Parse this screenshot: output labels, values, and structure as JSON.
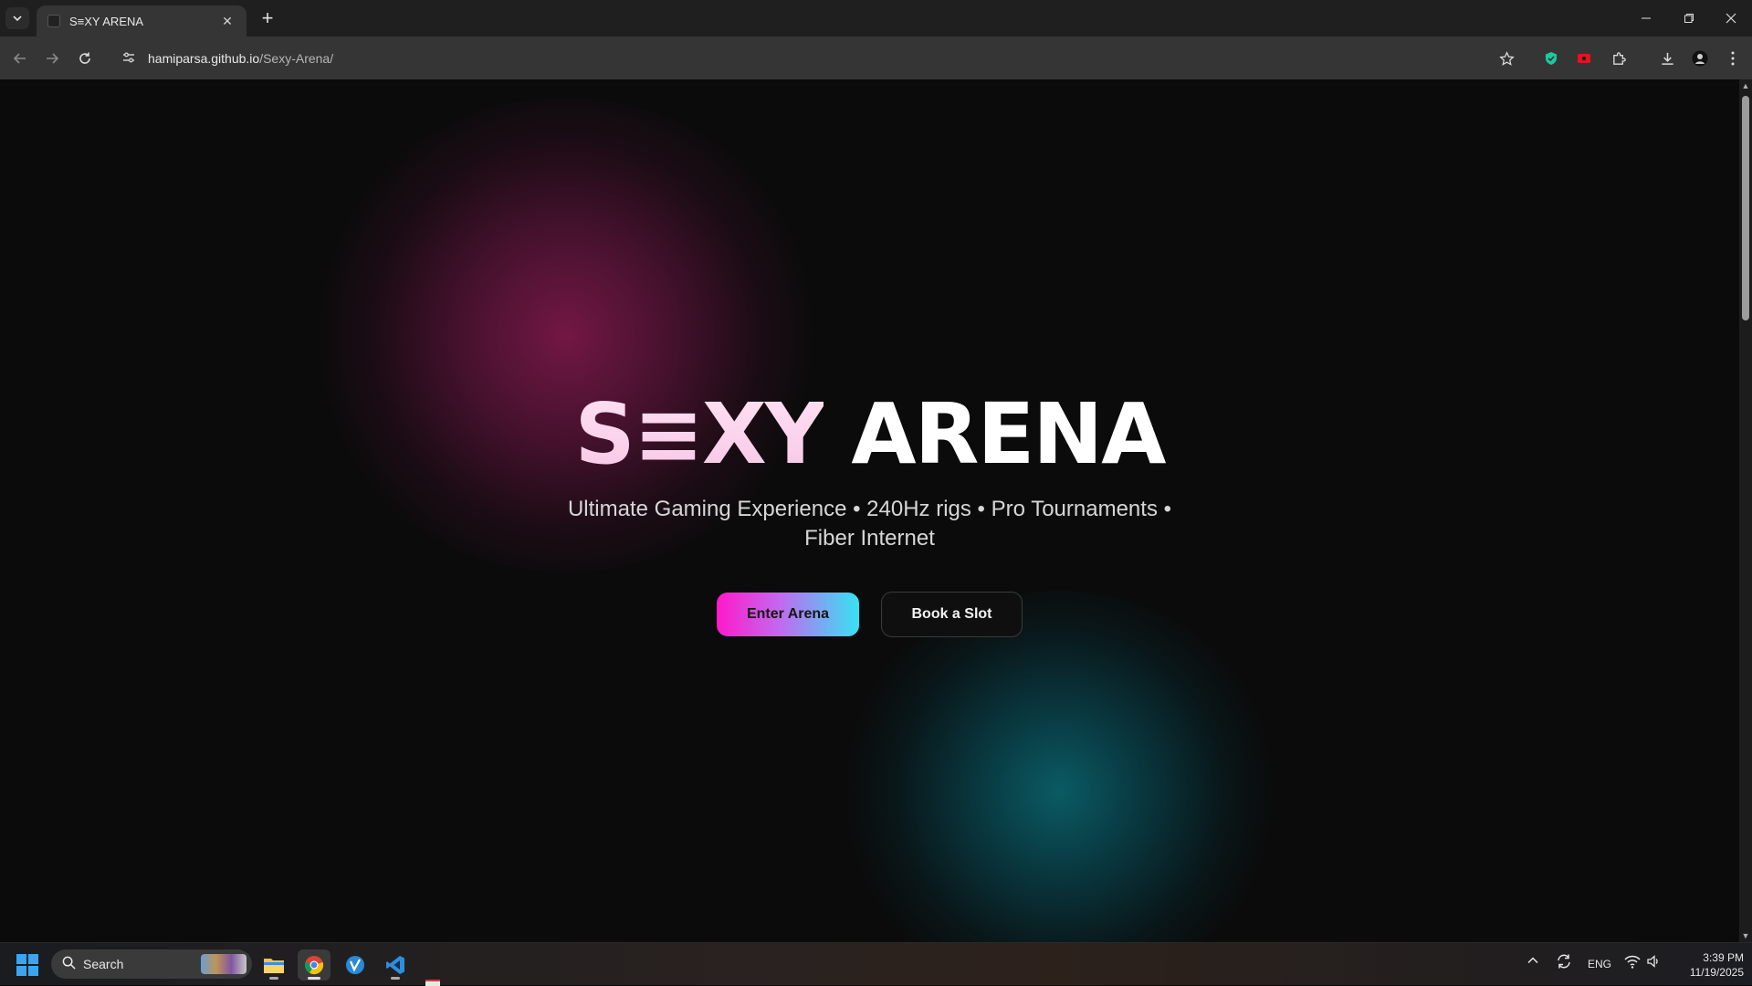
{
  "browser": {
    "tab_title": "S≡XY ARENA",
    "url_host": "hamiparsa.github.io",
    "url_path": "/Sexy-Arena/"
  },
  "hero": {
    "title_brand": "S≡XY",
    "title_rest": " ARENA",
    "subtitle": "Ultimate Gaming Experience • 240Hz rigs • Pro Tournaments • Fiber Internet",
    "primary_button": "Enter Arena",
    "secondary_button": "Book a Slot"
  },
  "colors": {
    "page_background": "#0b0b0b",
    "glow_pink": "#781848",
    "glow_cyan": "#0a5f69",
    "button_gradient_start": "#ff19c9",
    "button_gradient_end": "#36e3f3"
  },
  "taskbar": {
    "search_placeholder": "Search",
    "language": "ENG",
    "time": "3:39 PM",
    "date": "11/19/2025"
  },
  "icons": {
    "back": "arrow-left-icon",
    "forward": "arrow-right-icon",
    "reload": "reload-icon",
    "site_info": "tune-icon",
    "bookmark": "star-icon",
    "extensions": "puzzle-icon",
    "downloads": "download-icon",
    "menu": "kebab-menu-icon"
  }
}
